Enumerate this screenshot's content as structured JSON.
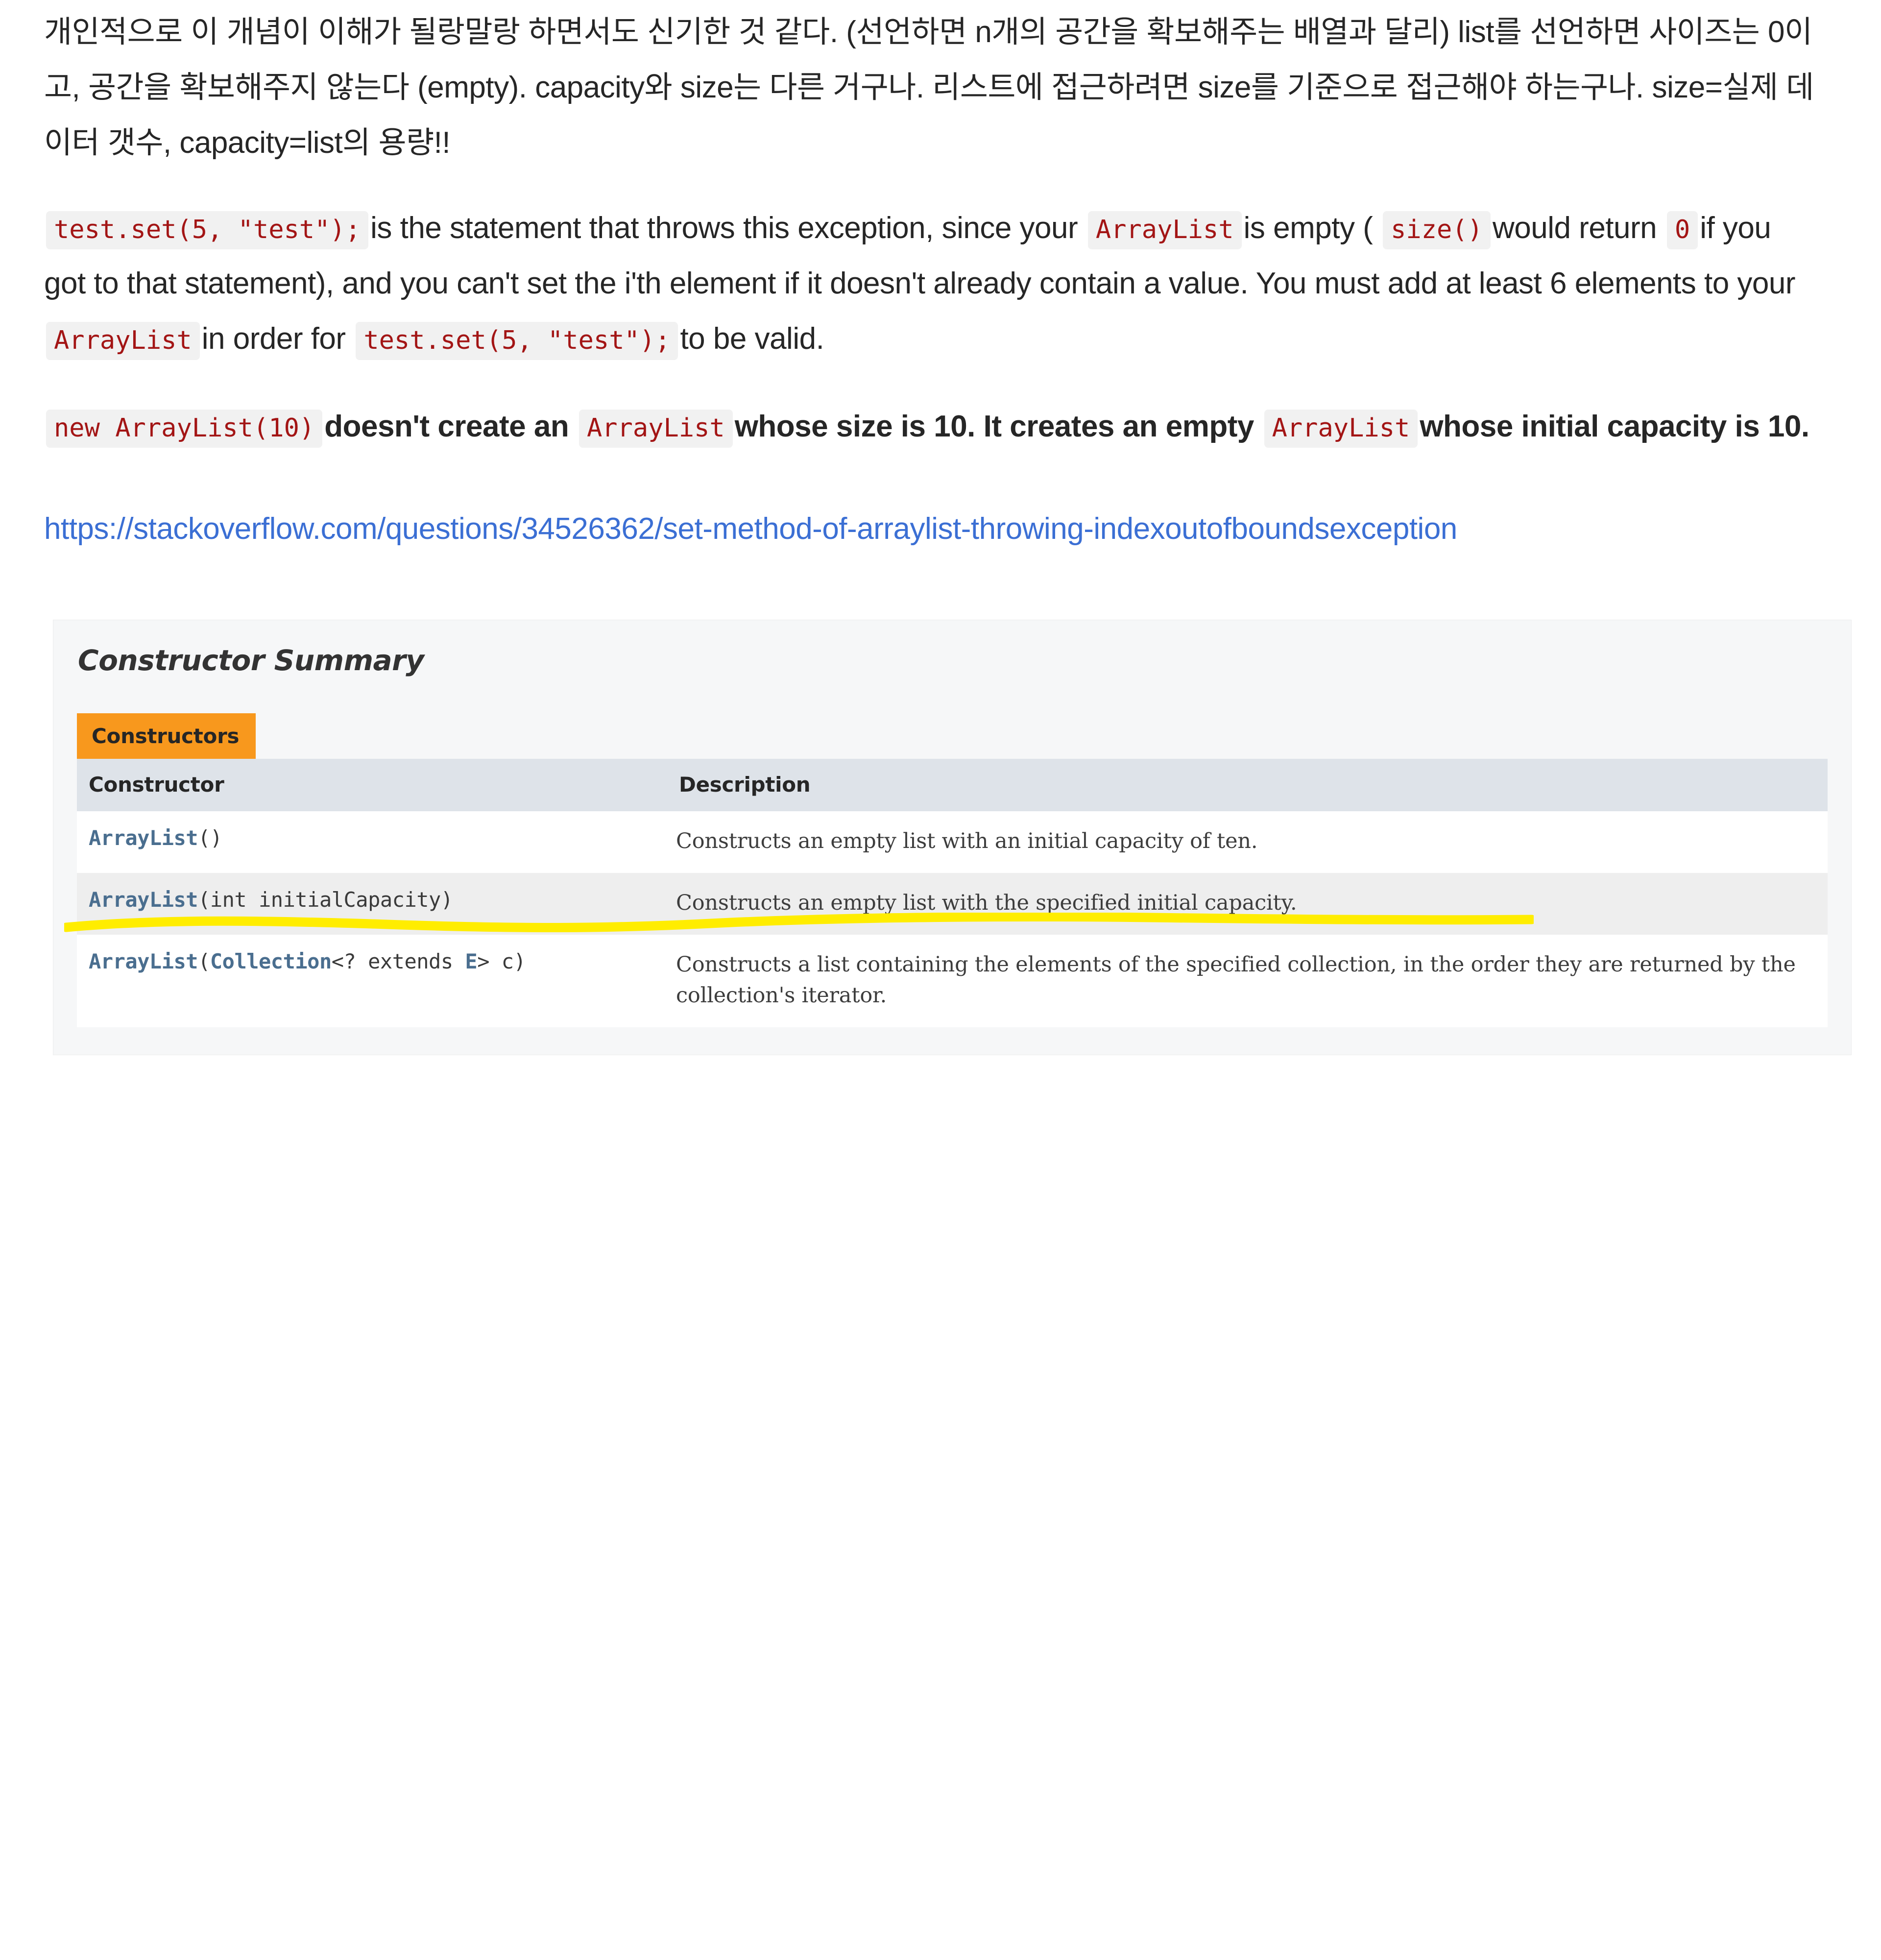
{
  "colors": {
    "code_text": "#a31515",
    "code_bg": "#f1f1f1",
    "link": "#3b6fd4",
    "tab_orange": "#f8981d",
    "table_header_bg": "#dee3e9",
    "row_alt_bg": "#eeeeee",
    "card_bg": "#f6f7f8",
    "javadoc_link": "#4a6e8f",
    "highlighter_yellow": "#ffed00"
  },
  "notes": {
    "korean_paragraph": "개인적으로 이 개념이 이해가 될랑말랑 하면서도 신기한 것 같다. (선언하면 n개의 공간을 확보해주는 배열과 달리) list를 선언하면 사이즈는 0이고, 공간을 확보해주지 않는다 (empty). capacity와 size는 다른 거구나. 리스트에 접근하려면 size를 기준으로 접근해야 하는구나. size=실제 데이터 갯수, capacity=list의 용량!!"
  },
  "quote": {
    "code_1": "test.set(5, \"test\");",
    "text_1": "is the statement that throws this exception, since your",
    "code_2": "ArrayList",
    "text_2": "is empty (",
    "code_3": "size()",
    "text_3": "would return",
    "code_4": "0",
    "text_4": "if you got to that statement), and you can't set the i'th element if it doesn't already contain a value. You must add at least 6 elements to your",
    "code_5": "ArrayList",
    "text_5": "in order for",
    "code_6": "test.set(5, \"test\");",
    "text_6": "to be valid."
  },
  "bold_quote": {
    "code_1": "new ArrayList(10)",
    "text_1": "doesn't create an",
    "code_2": "ArrayList",
    "text_2": "whose size is 10. It creates an empty",
    "code_3": "ArrayList",
    "text_3": "whose initial capacity is 10."
  },
  "link": {
    "text": "https://stackoverflow.com/questions/34526362/set-method-of-arraylist-throwing-indexoutofboundsexception"
  },
  "javadoc": {
    "title": "Constructor Summary",
    "tab_label": "Constructors",
    "headers": {
      "constructor": "Constructor",
      "description": "Description"
    },
    "rows": [
      {
        "sig_link": "ArrayList",
        "sig_rest": "()",
        "description": "Constructs an empty list with an initial capacity of ten.",
        "highlighted": false
      },
      {
        "sig_link": "ArrayList",
        "sig_rest": "(int initialCapacity)",
        "description": "Constructs an empty list with the specified initial capacity.",
        "highlighted": true
      },
      {
        "sig_link": "ArrayList",
        "sig_mid_open": "(",
        "sig_link2": "Collection",
        "sig_mid": "<? extends ",
        "sig_link3": "E",
        "sig_rest": "> c)",
        "description": "Constructs a list containing the elements of the specified collection, in the order they are returned by the collection's iterator.",
        "highlighted": false
      }
    ]
  }
}
